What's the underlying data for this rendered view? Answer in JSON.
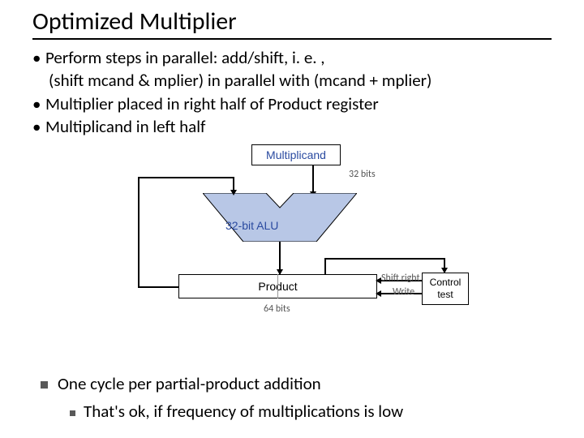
{
  "title": "Optimized Multiplier",
  "bullets": {
    "b1": "Perform steps in parallel: add/shift, i. e. ,",
    "b1_sub": "(shift mcand & mplier) in parallel with (mcand + mplier)",
    "b2": "Multiplier placed in right half of Product register",
    "b3": "Multiplicand in left half"
  },
  "diagram": {
    "multiplicand": "Multiplicand",
    "multiplicand_bits": "32 bits",
    "alu": "32-bit ALU",
    "product": "Product",
    "product_bits": "64 bits",
    "shift_right": "Shift right",
    "write": "Write",
    "control_l1": "Control",
    "control_l2": "test"
  },
  "bottom": {
    "line1": "One cycle per partial-product addition",
    "line2": "That's ok, if frequency of multiplications is low"
  }
}
